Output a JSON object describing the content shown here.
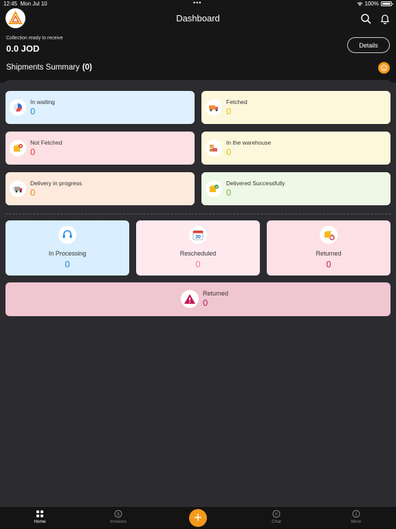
{
  "status_bar": {
    "time": "12:45",
    "date": "Mon Jul 10",
    "battery": "100%"
  },
  "header": {
    "title": "Dashboard"
  },
  "collection": {
    "label": "Collection ready to receive",
    "amount": "0.0 JOD",
    "details_label": "Details"
  },
  "summary": {
    "title": "Shipments Summary",
    "count": "(0)"
  },
  "cards": [
    {
      "label": "In waiting",
      "value": "0",
      "bg": "#dff1fe",
      "value_color": "#1e88c8",
      "icon": "pie-chart-icon"
    },
    {
      "label": "Fetched",
      "value": "0",
      "bg": "#fdf8dc",
      "value_color": "#e3c200",
      "icon": "delivery-truck-icon"
    },
    {
      "label": "Not Fetched",
      "value": "0",
      "bg": "#fde0e3",
      "value_color": "#e53935",
      "icon": "package-cancel-icon"
    },
    {
      "label": "In the warehouse",
      "value": "0",
      "bg": "#fdf8dc",
      "value_color": "#e3c200",
      "icon": "warehouse-boxes-icon"
    },
    {
      "label": "Delivery in progress",
      "value": "0",
      "bg": "#feeadc",
      "value_color": "#e08a1e",
      "icon": "truck-in-transit-icon"
    },
    {
      "label": "Delivered Successfully",
      "value": "0",
      "bg": "#eef8e6",
      "value_color": "#7cb342",
      "icon": "package-check-icon"
    }
  ],
  "big_cards": [
    {
      "label": "In Processing",
      "value": "0",
      "bg": "#d9eefe",
      "value_color": "#1e88c8",
      "icon": "support-headset-icon"
    },
    {
      "label": "Rescheduled",
      "value": "0",
      "bg": "#fde9ee",
      "value_color": "#ef7a9c",
      "icon": "calendar-icon",
      "icon_text": "30"
    },
    {
      "label": "Returned",
      "value": "0",
      "bg": "#fde0e6",
      "value_color": "#c2185b",
      "icon": "package-return-icon"
    }
  ],
  "wide_card": {
    "label": "Returned",
    "value": "0",
    "icon": "warning-icon"
  },
  "tabs": [
    {
      "label": "Home",
      "icon": "home-grid-icon"
    },
    {
      "label": "Invoices",
      "icon": "invoice-icon"
    },
    {
      "label": "Chat",
      "icon": "chat-icon"
    },
    {
      "label": "More",
      "icon": "info-icon"
    }
  ],
  "colors": {
    "accent": "#f39a1b",
    "header_bg": "#161616",
    "panel_bg": "#2c2c30"
  }
}
